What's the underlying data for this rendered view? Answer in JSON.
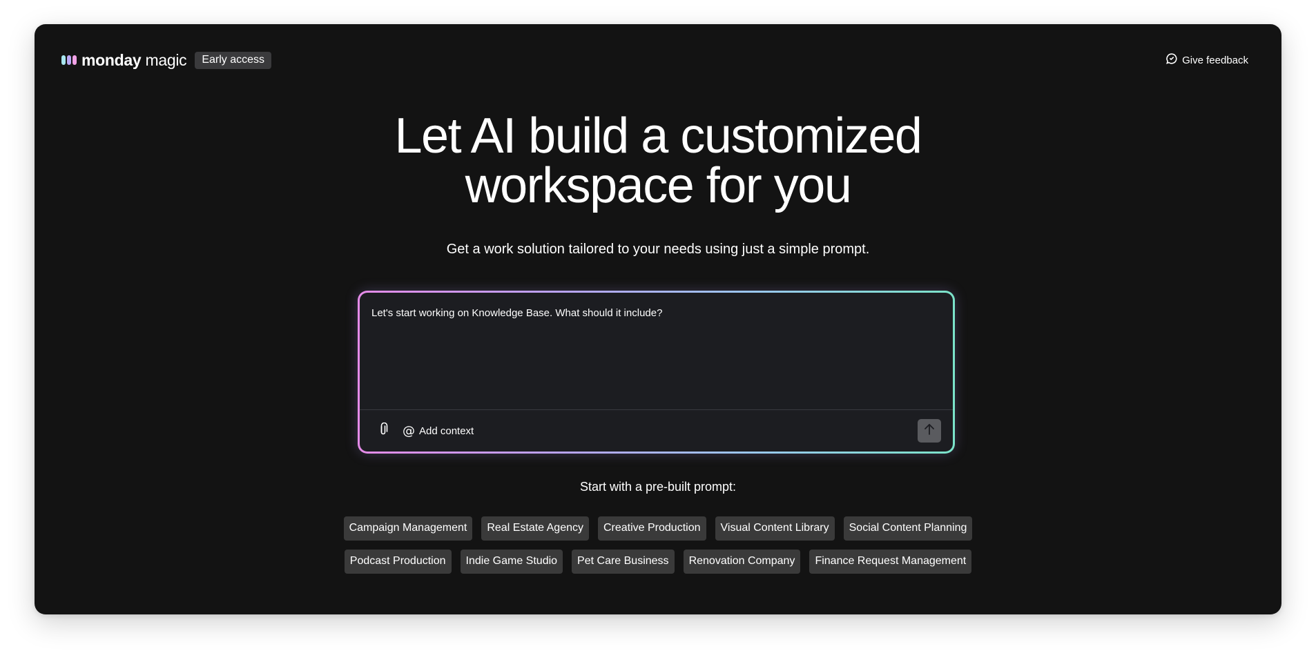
{
  "header": {
    "brand_bold": "monday",
    "brand_light": " magic",
    "badge": "Early access",
    "feedback_label": "Give feedback"
  },
  "hero": {
    "title_line1": "Let AI build a customized",
    "title_line2": "workspace for you",
    "subtitle": "Get a work solution tailored to your needs using just a simple prompt."
  },
  "prompt": {
    "value": "Let's start working on Knowledge Base. What should it include?",
    "add_context_label": "Add context",
    "attach_icon": "paperclip-icon",
    "send_icon": "arrow-up-icon",
    "gradient_colors": [
      "#e58be8",
      "#b7a3f0",
      "#9bc6f0",
      "#7be3c9"
    ]
  },
  "prebuilt": {
    "label": "Start with a pre-built prompt:",
    "row1": [
      "Campaign Management",
      "Real Estate Agency",
      "Creative Production",
      "Visual Content Library",
      "Social Content Planning"
    ],
    "row2": [
      "Podcast Production",
      "Indie Game Studio",
      "Pet Care Business",
      "Renovation Company",
      "Finance Request Management"
    ]
  },
  "colors": {
    "background": "#131313",
    "chip": "#3a3a3a",
    "logo": [
      "#a8e6f0",
      "#b9a8f5",
      "#f2a2e6"
    ]
  }
}
